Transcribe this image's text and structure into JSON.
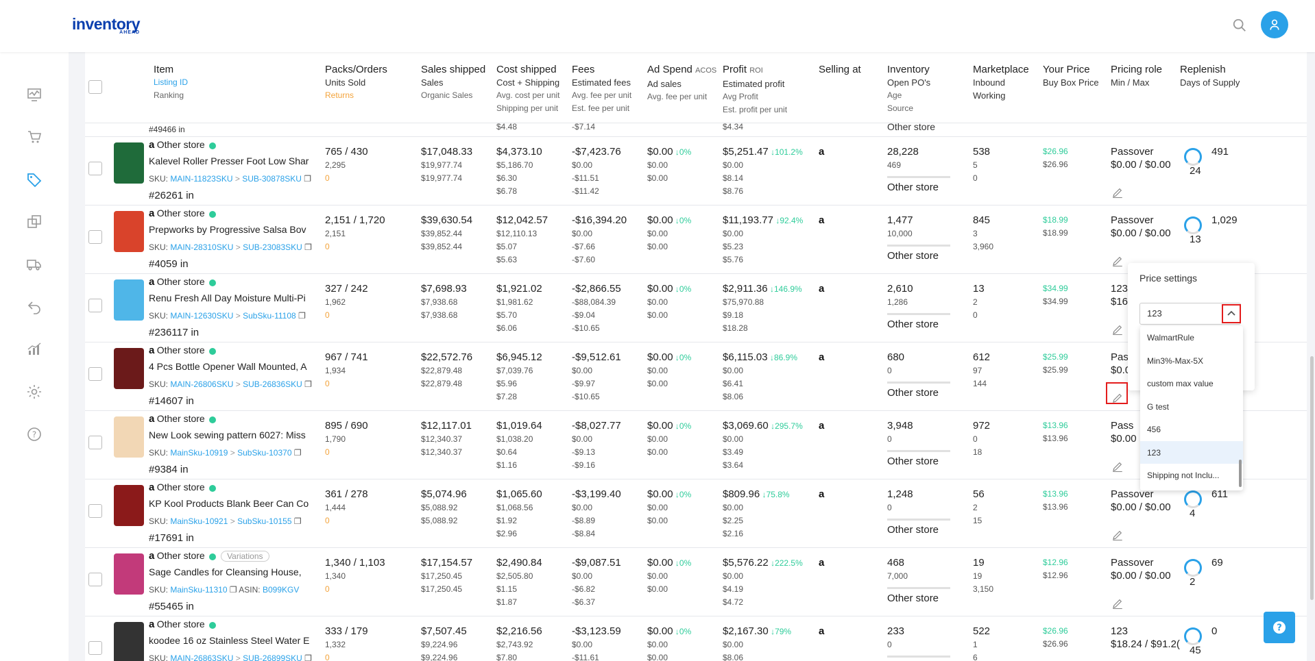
{
  "app": {
    "logo": "inventory",
    "logo_sub": "AHEAD"
  },
  "colors": {
    "brand": "#0b3fae",
    "accent": "#2aa1e8",
    "green": "#2ecc9a",
    "orange": "#f3a33b",
    "highlight": "#e31c1c"
  },
  "sidebar": {
    "icons": [
      "dashboard-icon",
      "cart-icon",
      "tag-icon",
      "layers-icon",
      "truck-icon",
      "return-icon",
      "chart-icon",
      "gear-icon",
      "help-circle-icon"
    ]
  },
  "columns": {
    "item": [
      "Item",
      "Listing ID",
      "Ranking"
    ],
    "packs": [
      "Packs/Orders",
      "Units Sold",
      "Returns"
    ],
    "sales": [
      "Sales shipped",
      "Sales",
      "Organic Sales"
    ],
    "cost": [
      "Cost shipped",
      "Cost + Shipping",
      "Avg. cost per unit",
      "Shipping per unit"
    ],
    "fees": [
      "Fees",
      "Estimated fees",
      "Avg. fee per unit",
      "Est. fee per unit"
    ],
    "ad": [
      "Ad Spend",
      "ACOS",
      "Ad sales",
      "Avg. fee per unit"
    ],
    "profit": [
      "Profit",
      "ROI",
      "Estimated profit",
      "Avg Profit",
      "Est. profit per unit"
    ],
    "selling": [
      "Selling at"
    ],
    "inventory": [
      "Inventory",
      "Open PO's",
      "Age",
      "Source"
    ],
    "marketplace": [
      "Marketplace",
      "Inbound",
      "Working"
    ],
    "price": [
      "Your Price",
      "Buy Box Price"
    ],
    "role": [
      "Pricing role",
      "Min / Max"
    ],
    "replenish": [
      "Replenish",
      "Days of Supply"
    ]
  },
  "partial_top": {
    "rank": "#49466 in",
    "cost": "$4.48",
    "fees": "-$7.14",
    "profit": "$4.34",
    "inventory": "Other store"
  },
  "rows": [
    {
      "store": "Other store",
      "title": "Kalevel Roller Presser Foot Low Shar",
      "sku": "MAIN-11823SKU",
      "sub": "SUB-30878SKU",
      "rank": "#26261 in",
      "packs": "765 / 430",
      "units": "2,295",
      "returns": "0",
      "sales1": "$17,048.33",
      "sales2": "$19,977.74",
      "sales3": "$19,977.74",
      "cost1": "$4,373.10",
      "cost2": "$5,186.70",
      "cost3": "$6.30",
      "cost4": "$6.78",
      "fee1": "-$7,423.76",
      "fee2": "$0.00",
      "fee3": "-$11.51",
      "fee4": "-$11.42",
      "ad1": "$0.00",
      "acos": "0%",
      "ad2": "$0.00",
      "ad3": "$0.00",
      "p1": "$5,251.47",
      "roi": "101.2%",
      "p2": "$0.00",
      "p3": "$8.14",
      "p4": "$8.76",
      "inv1": "28,228",
      "inv2": "469",
      "src": "Other store",
      "m1": "538",
      "m2": "5",
      "m3": "0",
      "yp": "$26.96",
      "bb": "$26.96",
      "role": "Passover",
      "minmax": "$0.00 / $0.00",
      "days": "24",
      "rep": "491",
      "thumb": "#1f6b3a"
    },
    {
      "store": "Other store",
      "title": "Prepworks by Progressive Salsa Bov",
      "sku": "MAIN-28310SKU",
      "sub": "SUB-23083SKU",
      "rank": "#4059 in",
      "packs": "2,151 / 1,720",
      "units": "2,151",
      "returns": "0",
      "sales1": "$39,630.54",
      "sales2": "$39,852.44",
      "sales3": "$39,852.44",
      "cost1": "$12,042.57",
      "cost2": "$12,110.13",
      "cost3": "$5.07",
      "cost4": "$5.63",
      "fee1": "-$16,394.20",
      "fee2": "$0.00",
      "fee3": "-$7.66",
      "fee4": "-$7.60",
      "ad1": "$0.00",
      "acos": "0%",
      "ad2": "$0.00",
      "ad3": "$0.00",
      "p1": "$11,193.77",
      "roi": "92.4%",
      "p2": "$0.00",
      "p3": "$5.23",
      "p4": "$5.76",
      "inv1": "1,477",
      "inv2": "10,000",
      "src": "Other store",
      "m1": "845",
      "m2": "3",
      "m3": "3,960",
      "yp": "$18.99",
      "bb": "$18.99",
      "role": "Passover",
      "minmax": "$0.00 / $0.00",
      "days": "13",
      "rep": "1,029",
      "thumb": "#d9432b"
    },
    {
      "store": "Other store",
      "title": "Renu Fresh All Day Moisture Multi-Pi",
      "sku": "MAIN-12630SKU",
      "sub": "SubSku-11108",
      "rank": "#236117 in",
      "packs": "327 / 242",
      "units": "1,962",
      "returns": "0",
      "sales1": "$7,698.93",
      "sales2": "$7,938.68",
      "sales3": "$7,938.68",
      "cost1": "$1,921.02",
      "cost2": "$1,981.62",
      "cost3": "$5.70",
      "cost4": "$6.06",
      "fee1": "-$2,866.55",
      "fee2": "-$88,084.39",
      "fee3": "-$9.04",
      "fee4": "-$10.65",
      "ad1": "$0.00",
      "acos": "0%",
      "ad2": "$0.00",
      "ad3": "$0.00",
      "p1": "$2,911.36",
      "roi": "146.9%",
      "p2": "$75,970.88",
      "p3": "$9.18",
      "p4": "$18.28",
      "inv1": "2,610",
      "inv2": "1,286",
      "src": "Other store",
      "m1": "13",
      "m2": "2",
      "m3": "0",
      "yp": "$34.99",
      "bb": "$34.99",
      "role": "123",
      "minmax": "$16.",
      "days": "",
      "rep": "",
      "thumb": "#4fb6e8"
    },
    {
      "store": "Other store",
      "title": "4 Pcs Bottle Opener Wall Mounted, A",
      "sku": "MAIN-26806SKU",
      "sub": "SUB-26836SKU",
      "rank": "#14607 in",
      "packs": "967 / 741",
      "units": "1,934",
      "returns": "0",
      "sales1": "$22,572.76",
      "sales2": "$22,879.48",
      "sales3": "$22,879.48",
      "cost1": "$6,945.12",
      "cost2": "$7,039.76",
      "cost3": "$5.96",
      "cost4": "$7.28",
      "fee1": "-$9,512.61",
      "fee2": "$0.00",
      "fee3": "-$9.97",
      "fee4": "-$10.65",
      "ad1": "$0.00",
      "acos": "0%",
      "ad2": "$0.00",
      "ad3": "$0.00",
      "p1": "$6,115.03",
      "roi": "86.9%",
      "p2": "$0.00",
      "p3": "$6.41",
      "p4": "$8.06",
      "inv1": "680",
      "inv2": "0",
      "src": "Other store",
      "m1": "612",
      "m2": "97",
      "m3": "144",
      "yp": "$25.99",
      "bb": "$25.99",
      "role": "Pas",
      "minmax": "$0.0",
      "days": "",
      "rep": "",
      "thumb": "#6b1a1a"
    },
    {
      "store": "Other store",
      "title": "New Look sewing pattern 6027: Miss",
      "sku": "MainSku-10919",
      "sub": "SubSku-10370",
      "rank": "#9384 in",
      "packs": "895 / 690",
      "units": "1,790",
      "returns": "0",
      "sales1": "$12,117.01",
      "sales2": "$12,340.37",
      "sales3": "$12,340.37",
      "cost1": "$1,019.64",
      "cost2": "$1,038.20",
      "cost3": "$0.64",
      "cost4": "$1.16",
      "fee1": "-$8,027.77",
      "fee2": "$0.00",
      "fee3": "-$9.13",
      "fee4": "-$9.16",
      "ad1": "$0.00",
      "acos": "0%",
      "ad2": "$0.00",
      "ad3": "$0.00",
      "p1": "$3,069.60",
      "roi": "295.7%",
      "p2": "$0.00",
      "p3": "$3.49",
      "p4": "$3.64",
      "inv1": "3,948",
      "inv2": "0",
      "src": "Other store",
      "m1": "972",
      "m2": "0",
      "m3": "18",
      "yp": "$13.96",
      "bb": "$13.96",
      "role": "Pass",
      "minmax": "$0.00",
      "days": "",
      "rep": "",
      "thumb": "#f2d7b5"
    },
    {
      "store": "Other store",
      "title": "KP Kool Products Blank Beer Can Co",
      "sku": "MainSku-10921",
      "sub": "SubSku-10155",
      "rank": "#17691 in",
      "packs": "361 / 278",
      "units": "1,444",
      "returns": "0",
      "sales1": "$5,074.96",
      "sales2": "$5,088.92",
      "sales3": "$5,088.92",
      "cost1": "$1,065.60",
      "cost2": "$1,068.56",
      "cost3": "$1.92",
      "cost4": "$2.96",
      "fee1": "-$3,199.40",
      "fee2": "$0.00",
      "fee3": "-$8.89",
      "fee4": "-$8.84",
      "ad1": "$0.00",
      "acos": "0%",
      "ad2": "$0.00",
      "ad3": "$0.00",
      "p1": "$809.96",
      "roi": "75.8%",
      "p2": "$0.00",
      "p3": "$2.25",
      "p4": "$2.16",
      "inv1": "1,248",
      "inv2": "0",
      "src": "Other store",
      "m1": "56",
      "m2": "2",
      "m3": "15",
      "yp": "$13.96",
      "bb": "$13.96",
      "role": "Passover",
      "minmax": "$0.00 / $0.00",
      "days": "4",
      "rep": "611",
      "thumb": "#8b1a1a"
    },
    {
      "store": "Other store",
      "title": "Sage Candles for Cleansing House,",
      "sku": "MainSku-11310",
      "sub": "",
      "asin": "B099KGV",
      "variations": "Variations",
      "rank": "#55465 in",
      "packs": "1,340 / 1,103",
      "units": "1,340",
      "returns": "0",
      "sales1": "$17,154.57",
      "sales2": "$17,250.45",
      "sales3": "$17,250.45",
      "cost1": "$2,490.84",
      "cost2": "$2,505.80",
      "cost3": "$1.15",
      "cost4": "$1.87",
      "fee1": "-$9,087.51",
      "fee2": "$0.00",
      "fee3": "-$6.82",
      "fee4": "-$6.37",
      "ad1": "$0.00",
      "acos": "0%",
      "ad2": "$0.00",
      "ad3": "$0.00",
      "p1": "$5,576.22",
      "roi": "222.5%",
      "p2": "$0.00",
      "p3": "$4.19",
      "p4": "$4.72",
      "inv1": "468",
      "inv2": "7,000",
      "src": "Other store",
      "m1": "19",
      "m2": "19",
      "m3": "3,150",
      "yp": "$12.96",
      "bb": "$12.96",
      "role": "Passover",
      "minmax": "$0.00 / $0.00",
      "days": "2",
      "rep": "69",
      "thumb": "#c23a7a"
    },
    {
      "store": "Other store",
      "title": "koodee 16 oz Stainless Steel Water E",
      "sku": "MAIN-26863SKU",
      "sub": "SUB-26899SKU",
      "rank": "",
      "packs": "333 / 179",
      "units": "1,332",
      "returns": "0",
      "sales1": "$7,507.45",
      "sales2": "$9,224.96",
      "sales3": "$9,224.96",
      "cost1": "$2,216.56",
      "cost2": "$2,743.92",
      "cost3": "$7.80",
      "cost4": "",
      "fee1": "-$3,123.59",
      "fee2": "$0.00",
      "fee3": "-$11.61",
      "fee4": "",
      "ad1": "$0.00",
      "acos": "0%",
      "ad2": "$0.00",
      "ad3": "$0.00",
      "p1": "$2,167.30",
      "roi": "79%",
      "p2": "$0.00",
      "p3": "$8.06",
      "p4": "",
      "inv1": "233",
      "inv2": "0",
      "src": "",
      "m1": "522",
      "m2": "1",
      "m3": "6",
      "yp": "$26.96",
      "bb": "$26.96",
      "role": "123",
      "minmax": "$18.24 / $91.2(",
      "days": "45",
      "rep": "0",
      "thumb": "#333333"
    }
  ],
  "popover": {
    "title": "Price settings",
    "value": "123",
    "options": [
      "WalmartRule",
      "Min3%-Max-5X",
      "custom max value",
      "G test",
      "456",
      "123",
      "Shipping not Inclu..."
    ],
    "selected": "123"
  }
}
